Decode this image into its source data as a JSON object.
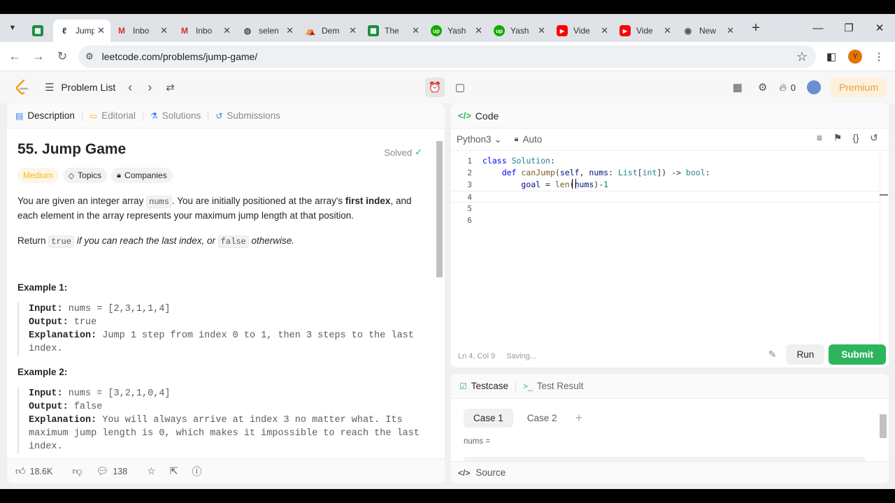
{
  "browser": {
    "tabs": [
      {
        "label": "Jump",
        "icon": "leetcode-icon",
        "active": true
      },
      {
        "label": "Inbo",
        "icon": "gmail-icon"
      },
      {
        "label": "Inbo",
        "icon": "gmail-icon"
      },
      {
        "label": "selen",
        "icon": "globe-icon"
      },
      {
        "label": "Dem",
        "icon": "store-icon"
      },
      {
        "label": "The",
        "icon": "sheets-icon"
      },
      {
        "label": "Yash",
        "icon": "upwork-icon"
      },
      {
        "label": "Yash",
        "icon": "upwork-icon"
      },
      {
        "label": "Vide",
        "icon": "youtube-icon"
      },
      {
        "label": "Vide",
        "icon": "youtube-icon"
      },
      {
        "label": "New",
        "icon": "chrome-icon"
      }
    ],
    "url": "leetcode.com/problems/jump-game/",
    "profile_initial": "Y"
  },
  "nav": {
    "problem_list": "Problem List",
    "streak_count": "0",
    "premium": "Premium"
  },
  "left": {
    "tabs": {
      "description": "Description",
      "editorial": "Editorial",
      "solutions": "Solutions",
      "submissions": "Submissions"
    },
    "title": "55. Jump Game",
    "solved": "Solved",
    "badges": {
      "difficulty": "Medium",
      "topics": "Topics",
      "companies": "Companies"
    },
    "desc": {
      "p1a": "You are given an integer array ",
      "p1code": "nums",
      "p1b": ". You are initially positioned at the array's ",
      "p1bold": "first index",
      "p1c": ", and each element in the array represents your maximum jump length at that position.",
      "p2a": "Return ",
      "p2code1": "true",
      "p2b": " if you can reach the last index, or ",
      "p2code2": "false",
      "p2c": " otherwise."
    },
    "example1": {
      "heading": "Example 1:",
      "input_label": "Input:",
      "input": " nums = [2,3,1,1,4]",
      "output_label": "Output:",
      "output": " true",
      "explanation_label": "Explanation:",
      "explanation": " Jump 1 step from index 0 to 1, then 3 steps to the last index."
    },
    "example2": {
      "heading": "Example 2:",
      "input_label": "Input:",
      "input": " nums = [3,2,1,0,4]",
      "output_label": "Output:",
      "output": " false",
      "explanation_label": "Explanation:",
      "explanation": " You will always arrive at index 3 no matter what. Its maximum jump length is 0, which makes it impossible to reach the last index."
    },
    "footer": {
      "likes": "18.6K",
      "comments": "138"
    }
  },
  "code": {
    "header": "Code",
    "language": "Python3",
    "mode": "Auto",
    "lines": [
      "1",
      "2",
      "3",
      "4",
      "5",
      "6"
    ],
    "status_pos": "Ln 4, Col 9",
    "status_save": "Saving...",
    "run": "Run",
    "submit": "Submit"
  },
  "testcase": {
    "tab1": "Testcase",
    "tab2": "Test Result",
    "case1": "Case 1",
    "case2": "Case 2",
    "nums_label": "nums =",
    "source": "Source"
  }
}
